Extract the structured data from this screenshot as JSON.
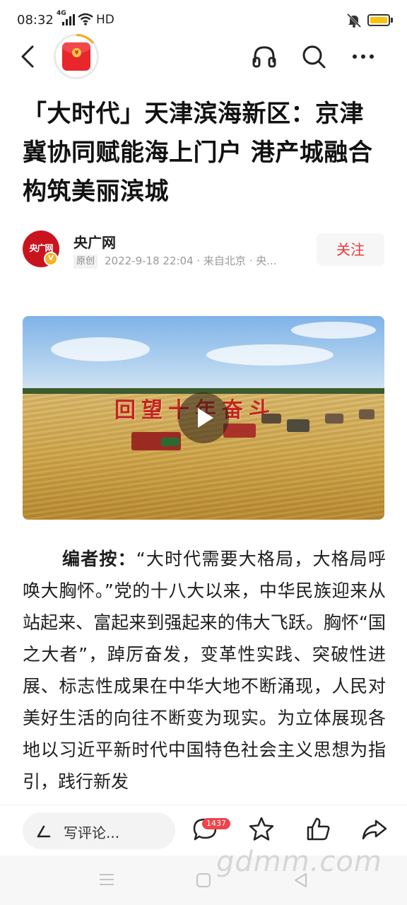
{
  "status_bar": {
    "time": "08:32",
    "network": "4G",
    "quality": "HD"
  },
  "header": {
    "back_icon": "back-arrow-icon",
    "avatar_icon": "red-packet-icon",
    "listen_icon": "headphones-icon",
    "search_icon": "search-icon",
    "more_icon": "more-dots-icon"
  },
  "article": {
    "title": "「大时代」天津滨海新区：京津冀协同赋能海上门户 港产城融合构筑美丽滨城",
    "author": {
      "avatar_text": "央广网",
      "name": "央广网",
      "original_tag": "原创",
      "meta": "2022-9-18 22:04 · 来自北京 · 央..."
    },
    "follow_label": "关注",
    "video": {
      "caption": "回望十年奋斗"
    },
    "body_lead": "编者按：",
    "body_text": "“大时代需要大格局，大格局呼唤大胸怀。”党的十八大以来，中华民族迎来从站起来、富起来到强起来的伟大飞跃。胸怀“国之大者”，踔厉奋发，变革性实践、突破性进展、标志性成果在中华大地不断涌现，人民对美好生活的向往不断变为现实。为立体展现各地以习近平新时代中国特色社会主义思想为指引，践行新发"
  },
  "bottom_bar": {
    "comment_placeholder": "写评论...",
    "comment_count": "1437"
  },
  "watermark": "gdmm.com",
  "colors": {
    "accent_red": "#e8383d",
    "badge_red": "#f0434a",
    "battery_yellow": "#f3c511"
  }
}
